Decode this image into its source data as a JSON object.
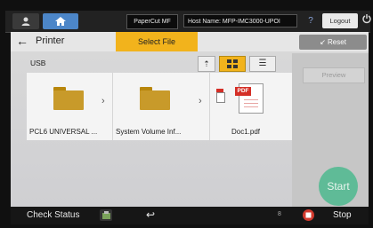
{
  "topbar": {
    "app_tag": "PaperCut MF",
    "host_name": "Host Name: MFP-IMC3000-UPOI",
    "help_glyph": "?",
    "logout_label": "Logout"
  },
  "header": {
    "back_glyph": "←",
    "title": "Printer",
    "select_file_label": "Select File",
    "reset_label": "Reset"
  },
  "location": {
    "label": "USB"
  },
  "view_controls": {
    "up_glyph": "⇡",
    "list_glyph": "☰"
  },
  "files": [
    {
      "name": "PCL6 UNIVERSAL ...",
      "type": "folder"
    },
    {
      "name": "System Volume Inf...",
      "type": "folder"
    },
    {
      "name": "Doc1.pdf",
      "type": "pdf"
    }
  ],
  "pdf_badge": "PDF",
  "right_panel": {
    "preview_label": "Preview",
    "start_label": "Start"
  },
  "bottombar": {
    "check_status_label": "Check Status",
    "stop_label": "Stop",
    "return_glyph": "↩",
    "indicator_text": "8"
  },
  "colors": {
    "accent": "#f2b31c",
    "start": "#5fbb97",
    "stop": "#d23a2e",
    "home": "#4c86c8"
  }
}
